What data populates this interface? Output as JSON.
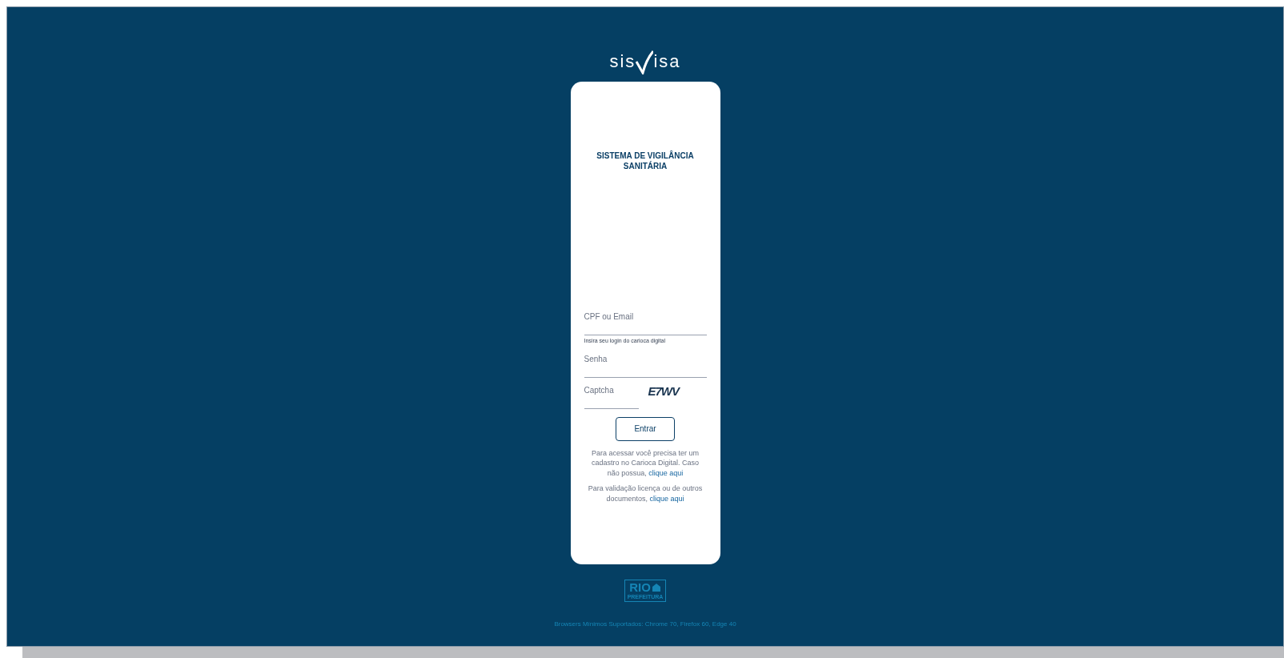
{
  "logo": {
    "before": "sis",
    "after": "isa"
  },
  "card": {
    "title": "SISTEMA DE VIGILÂNCIA SANITÁRIA",
    "fields": [
      {
        "label": "CPF ou Email",
        "hint": "Insira seu login do carioca digital"
      },
      {
        "label": "Senha"
      }
    ],
    "captcha": {
      "label": "Captcha",
      "code": "E7WV"
    },
    "button": "Entrar",
    "notes": [
      {
        "text": "Para acessar você precisa ter um cadastro no Carioca Digital. Caso não possua,",
        "link": "clique aqui"
      },
      {
        "text": "Para validação licença ou de outros documentos,",
        "link": "clique aqui"
      }
    ]
  },
  "footer_logo": {
    "main": "RIO",
    "sub": "PREFEITURA"
  },
  "footer": "Browsers Mínimos Suportados: Chrome 70, Firefox 60, Edge 40"
}
